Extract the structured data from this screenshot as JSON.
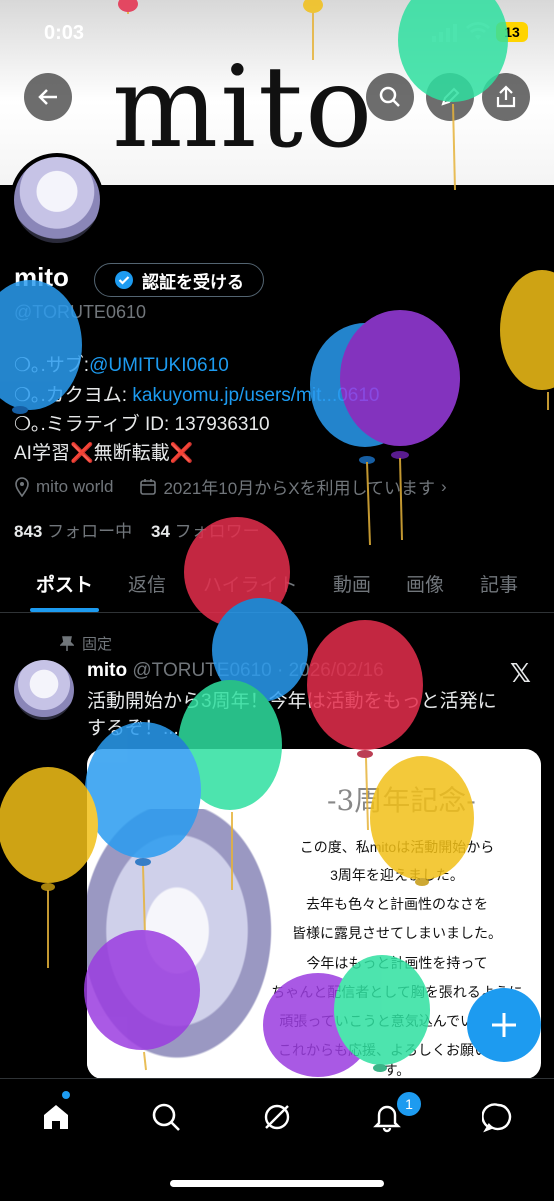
{
  "status_bar": {
    "time": "0:03",
    "battery": "13"
  },
  "banner": {
    "text": "mito"
  },
  "profile": {
    "name": "mito",
    "verify_label": "認証を受ける",
    "handle": "@TORUTE0610",
    "bio": {
      "sub_prefix": "❍｡.サブ:",
      "sub_link": "@UMITUKI0610",
      "kakuyomu_prefix": "❍｡.カクヨム: ",
      "kakuyomu_link": "kakuyomu.jp/users/mit...0610",
      "miratib": "❍｡.ミラティブ ID: 137936310",
      "ai_line": "AI学習❌無断転載❌"
    },
    "location": "mito world",
    "joined": "2021年10月からXを利用しています",
    "following_count": "843",
    "following_label": "フォロー中",
    "followers_count": "34",
    "followers_label": "フォロワー"
  },
  "tabs": [
    "ポスト",
    "返信",
    "ハイライト",
    "動画",
    "画像",
    "記事"
  ],
  "post": {
    "pinned_label": "固定",
    "author": "mito",
    "handle_date": "@TORUTE0610 · 2026/02/16",
    "text": "活動開始から3周年！今年は活動をもっと活発にするぞ！...",
    "image": {
      "title": "-3周年記念-",
      "lines": [
        "この度、私mitoは活動開始から",
        "3周年を迎えました。",
        "去年も色々と計画性のなさを",
        "皆様に露見させてしまいました。",
        "今年はもっと計画性を持って",
        "ちゃんと配信者として胸を張れるように",
        "頑張っていこうと意気込んでいます。",
        "これからも応援、よろしくお願いします。"
      ]
    }
  },
  "nav": {
    "notifications_badge": "1"
  },
  "colors": {
    "accent": "#1d9bf0",
    "background": "#000000"
  }
}
